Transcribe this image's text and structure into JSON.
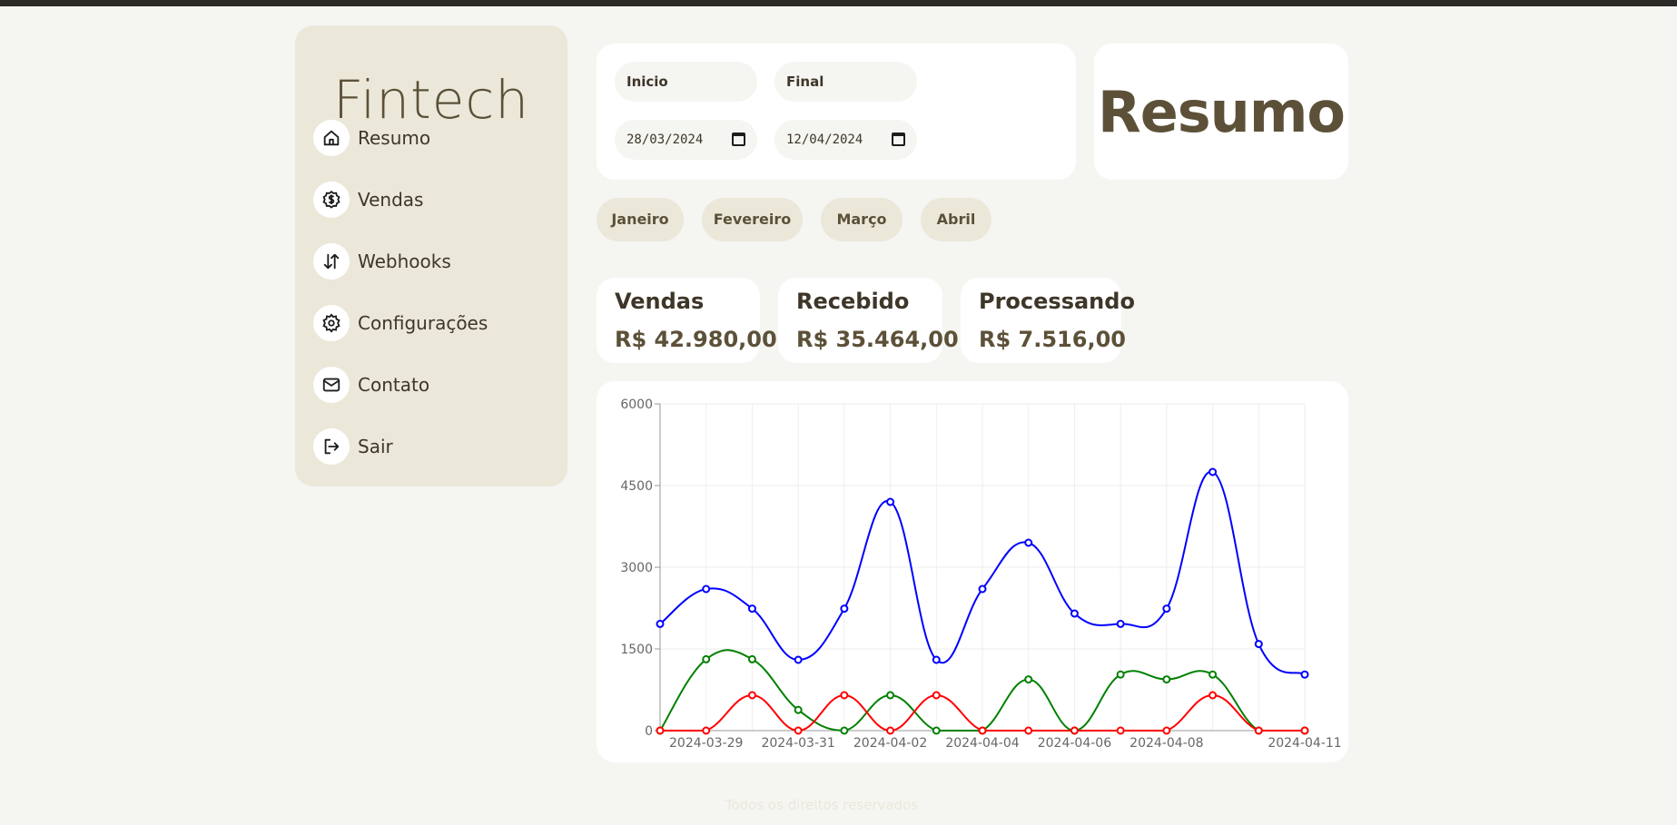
{
  "sidebar": {
    "brand": "Fintech",
    "items": [
      {
        "label": "Resumo",
        "icon": "home-icon"
      },
      {
        "label": "Vendas",
        "icon": "dollar-badge-icon"
      },
      {
        "label": "Webhooks",
        "icon": "arrows-up-down-icon"
      },
      {
        "label": "Configurações",
        "icon": "gear-icon"
      },
      {
        "label": "Contato",
        "icon": "mail-icon"
      },
      {
        "label": "Sair",
        "icon": "logout-icon"
      }
    ]
  },
  "dates": {
    "start_label": "Inicio",
    "end_label": "Final",
    "start_value": "28/03/2024",
    "end_value": "12/04/2024"
  },
  "page_title": "Resumo",
  "months": [
    "Janeiro",
    "Fevereiro",
    "Março",
    "Abril"
  ],
  "stats": [
    {
      "title": "Vendas",
      "value": "R$ 42.980,00"
    },
    {
      "title": "Recebido",
      "value": "R$ 35.464,00"
    },
    {
      "title": "Processando",
      "value": "R$ 7.516,00"
    }
  ],
  "chart_data": {
    "type": "line",
    "x": [
      "2024-03-28",
      "2024-03-29",
      "2024-03-30",
      "2024-03-31",
      "2024-04-01",
      "2024-04-02",
      "2024-04-03",
      "2024-04-04",
      "2024-04-05",
      "2024-04-06",
      "2024-04-07",
      "2024-04-08",
      "2024-04-09",
      "2024-04-10",
      "2024-04-11"
    ],
    "x_tick_labels": [
      "2024-03-29",
      "2024-03-31",
      "2024-04-02",
      "2024-04-04",
      "2024-04-06",
      "2024-04-08",
      "2024-04-11"
    ],
    "ylim": [
      0,
      6000
    ],
    "y_ticks": [
      0,
      1500,
      3000,
      4500,
      6000
    ],
    "grid": true,
    "series": [
      {
        "color": "#0000ff",
        "values": [
          1960,
          2600,
          2240,
          1300,
          2240,
          4200,
          1300,
          2600,
          3450,
          2150,
          1960,
          2240,
          4750,
          1590,
          1030
        ]
      },
      {
        "color": "#008000",
        "values": [
          0,
          1310,
          1310,
          380,
          0,
          650,
          0,
          0,
          940,
          0,
          1030,
          940,
          1030,
          0,
          0
        ]
      },
      {
        "color": "#ff0000",
        "values": [
          0,
          0,
          650,
          0,
          650,
          0,
          650,
          0,
          0,
          0,
          0,
          0,
          650,
          0,
          0
        ]
      }
    ]
  },
  "footer": "Todos os direitos reservados"
}
